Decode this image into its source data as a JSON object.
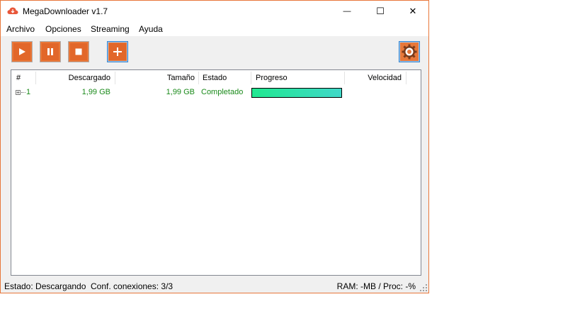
{
  "window": {
    "title": "MegaDownloader v1.7",
    "minimize_glyph": "—",
    "maximize_glyph": "☐",
    "close_glyph": "✕"
  },
  "menu": [
    "Archivo",
    "Opciones",
    "Streaming",
    "Ayuda"
  ],
  "toolbar": {
    "icons": [
      "play-icon",
      "pause-icon",
      "stop-icon",
      "add-icon",
      "settings-gear-icon"
    ],
    "accent": "#e8783a"
  },
  "table": {
    "columns": [
      "#",
      "Descargado",
      "Tamaño",
      "Estado",
      "Progreso",
      "Velocidad"
    ],
    "rows": [
      {
        "num": "1",
        "descargado": "1,99 GB",
        "tamano": "1,99 GB",
        "estado": "Completado",
        "progreso": 100,
        "velocidad": ""
      }
    ],
    "row_text_color": "#1a8a1a"
  },
  "status": {
    "estado": "Estado: Descargando",
    "conexiones": "Conf. conexiones: 3/3",
    "ram": "RAM: -MB / Proc: -%"
  }
}
